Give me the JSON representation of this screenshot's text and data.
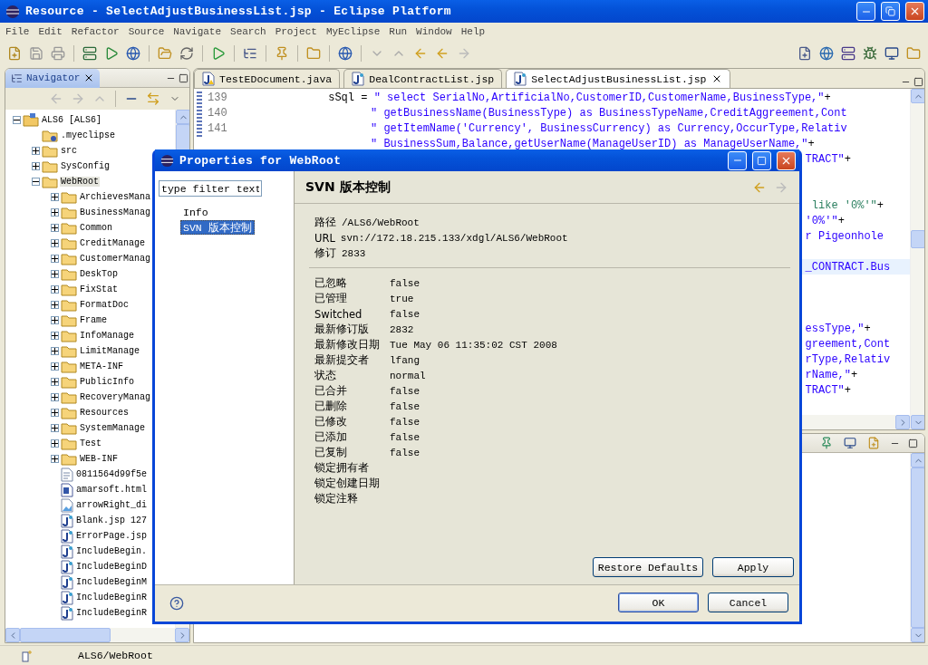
{
  "window": {
    "title": "Resource - SelectAdjustBusinessList.jsp - Eclipse Platform"
  },
  "menu": [
    "File",
    "Edit",
    "Refactor",
    "Source",
    "Navigate",
    "Search",
    "Project",
    "MyEclipse",
    "Run",
    "Window",
    "Help"
  ],
  "navigator": {
    "title": "Navigator",
    "tree": [
      {
        "label": "ALS6 [ALS6]",
        "kind": "project",
        "expanded": true,
        "selected": false,
        "children": [
          {
            "label": ".myeclipse",
            "kind": "meta",
            "selected": false
          },
          {
            "label": "src",
            "kind": "folder",
            "expanded": false,
            "selected": false
          },
          {
            "label": "SysConfig",
            "kind": "folder",
            "expanded": false,
            "selected": false
          },
          {
            "label": "WebRoot",
            "kind": "folder",
            "expanded": true,
            "selected": true,
            "children": [
              {
                "label": "ArchievesMana",
                "kind": "folder",
                "expanded": false,
                "selected": false
              },
              {
                "label": "BusinessManag",
                "kind": "folder",
                "expanded": false,
                "selected": false
              },
              {
                "label": "Common",
                "kind": "folder",
                "expanded": false,
                "selected": false
              },
              {
                "label": "CreditManage",
                "kind": "folder",
                "expanded": false,
                "selected": false
              },
              {
                "label": "CustomerManag",
                "kind": "folder",
                "expanded": false,
                "selected": false
              },
              {
                "label": "DeskTop",
                "kind": "folder",
                "expanded": false,
                "selected": false
              },
              {
                "label": "FixStat",
                "kind": "folder",
                "expanded": false,
                "selected": false
              },
              {
                "label": "FormatDoc",
                "kind": "folder",
                "expanded": false,
                "selected": false
              },
              {
                "label": "Frame",
                "kind": "folder",
                "expanded": false,
                "selected": false
              },
              {
                "label": "InfoManage",
                "kind": "folder",
                "expanded": false,
                "selected": false
              },
              {
                "label": "LimitManage",
                "kind": "folder",
                "expanded": false,
                "selected": false
              },
              {
                "label": "META-INF",
                "kind": "folder",
                "expanded": false,
                "selected": false
              },
              {
                "label": "PublicInfo",
                "kind": "folder",
                "expanded": false,
                "selected": false
              },
              {
                "label": "RecoveryManag",
                "kind": "folder",
                "expanded": false,
                "selected": false
              },
              {
                "label": "Resources",
                "kind": "folder",
                "expanded": false,
                "selected": false
              },
              {
                "label": "SystemManage",
                "kind": "folder",
                "expanded": false,
                "selected": false
              },
              {
                "label": "Test",
                "kind": "folder",
                "expanded": false,
                "selected": false
              },
              {
                "label": "WEB-INF",
                "kind": "folder",
                "expanded": false,
                "selected": false
              },
              {
                "label": "0811564d99f5e",
                "kind": "file",
                "selected": false
              },
              {
                "label": "amarsoft.html",
                "kind": "html",
                "selected": false
              },
              {
                "label": "arrowRight_di",
                "kind": "image",
                "selected": false
              },
              {
                "label": "Blank.jsp 127",
                "kind": "jsp",
                "selected": false
              },
              {
                "label": "ErrorPage.jsp",
                "kind": "jsp",
                "selected": false
              },
              {
                "label": "IncludeBegin.",
                "kind": "jsp",
                "selected": false
              },
              {
                "label": "IncludeBeginD",
                "kind": "jsp",
                "selected": false
              },
              {
                "label": "IncludeBeginM",
                "kind": "jsp",
                "selected": false
              },
              {
                "label": "IncludeBeginR",
                "kind": "jsp",
                "selected": false
              },
              {
                "label": "IncludeBeginR",
                "kind": "jsp",
                "selected": false
              }
            ]
          }
        ]
      }
    ]
  },
  "editor": {
    "tabs": [
      {
        "label": "TestEDocument.java",
        "kind": "java",
        "selected": false
      },
      {
        "label": "DealContractList.jsp",
        "kind": "jsp",
        "selected": false
      },
      {
        "label": "SelectAdjustBusinessList.jsp",
        "kind": "jsp",
        "selected": true
      }
    ],
    "lines": [
      {
        "number": "139",
        "kind": "start",
        "current": false,
        "segments": [
          {
            "text": "sSql = ",
            "kind": "plain"
          },
          {
            "text": "\" select SerialNo,ArtificialNo,CustomerID,CustomerName,BusinessType,\"",
            "kind": "string"
          },
          {
            "text": "+",
            "kind": "plain"
          }
        ]
      },
      {
        "number": "140",
        "kind": "cont",
        "current": false,
        "segments": [
          {
            "text": "\" getBusinessName(BusinessType) as BusinessTypeName,CreditAggreement,Cont",
            "kind": "string"
          }
        ]
      },
      {
        "number": "141",
        "kind": "cont",
        "current": false,
        "segments": [
          {
            "text": "\" getItemName('Currency', BusinessCurrency) as Currency,OccurType,Relativ",
            "kind": "string"
          }
        ]
      },
      {
        "kind": "cont",
        "current": false,
        "segments": [
          {
            "text": "\" BusinessSum,Balance,getUserName(ManageUserID) as ManageUserName,\"",
            "kind": "string"
          },
          {
            "text": "+",
            "kind": "plain"
          }
        ]
      },
      {
        "kind": "tail",
        "current": false,
        "segments": [
          {
            "text": "TRACT\"",
            "kind": "string"
          },
          {
            "text": "+",
            "kind": "plain"
          }
        ]
      },
      {
        "current": false
      },
      {
        "current": false
      },
      {
        "kind": "tail",
        "current": false,
        "segments": [
          {
            "text": " like '0%'\"",
            "kind": "sql"
          },
          {
            "text": "+",
            "kind": "plain"
          }
        ]
      },
      {
        "kind": "tail",
        "current": false,
        "segments": [
          {
            "text": "'0%'\"",
            "kind": "string"
          },
          {
            "text": "+",
            "kind": "plain"
          }
        ]
      },
      {
        "kind": "tail",
        "current": false,
        "segments": [
          {
            "text": "r Pigeonhole",
            "kind": "string"
          }
        ]
      },
      {
        "current": false
      },
      {
        "kind": "tail",
        "current": true,
        "segments": [
          {
            "text": "_CONTRACT.Bus",
            "kind": "string"
          }
        ]
      },
      {
        "current": false
      },
      {
        "current": false
      },
      {
        "current": false
      },
      {
        "kind": "tail",
        "current": false,
        "segments": [
          {
            "text": "essType,\"",
            "kind": "string"
          },
          {
            "text": "+",
            "kind": "plain"
          }
        ]
      },
      {
        "kind": "tail",
        "current": false,
        "segments": [
          {
            "text": "greement,Cont",
            "kind": "string"
          }
        ]
      },
      {
        "kind": "tail",
        "current": false,
        "segments": [
          {
            "text": "rType,Relativ",
            "kind": "string"
          }
        ]
      },
      {
        "kind": "tail",
        "current": false,
        "segments": [
          {
            "text": "rName,\"",
            "kind": "string"
          },
          {
            "text": "+",
            "kind": "plain"
          }
        ]
      },
      {
        "kind": "tail",
        "current": false,
        "segments": [
          {
            "text": "TRACT\"",
            "kind": "string"
          },
          {
            "text": "+",
            "kind": "plain"
          }
        ]
      }
    ]
  },
  "dialog": {
    "title": "Properties for WebRoot",
    "filter": {
      "placeholder": "type filter text"
    },
    "pages": [
      {
        "label": "Info",
        "selected": false
      },
      {
        "label": "SVN 版本控制",
        "selected": true
      }
    ],
    "heading": "SVN 版本控制",
    "summary": [
      {
        "label": "路径",
        "value": "/ALS6/WebRoot"
      },
      {
        "label": "URL",
        "value": "svn://172.18.215.133/xdgl/ALS6/WebRoot"
      },
      {
        "label": "修订",
        "value": "2833"
      }
    ],
    "properties": [
      {
        "label": "已忽略",
        "value": "false"
      },
      {
        "label": "已管理",
        "value": "true"
      },
      {
        "label": "Switched",
        "value": "false"
      },
      {
        "label": "最新修订版",
        "value": "2832"
      },
      {
        "label": "最新修改日期",
        "value": "Tue May 06 11:35:02 CST 2008"
      },
      {
        "label": "最新提交者",
        "value": "lfang"
      },
      {
        "label": "状态",
        "value": "normal"
      },
      {
        "label": "已合并",
        "value": "false"
      },
      {
        "label": "已删除",
        "value": "false"
      },
      {
        "label": "已修改",
        "value": "false"
      },
      {
        "label": "已添加",
        "value": "false"
      },
      {
        "label": "已复制",
        "value": "false"
      },
      {
        "label": "锁定拥有者"
      },
      {
        "label": "锁定创建日期"
      },
      {
        "label": "锁定注释"
      }
    ],
    "page_buttons": [
      "Restore Defaults",
      "Apply"
    ],
    "buttons": [
      "OK",
      "Cancel"
    ]
  },
  "status_bar": {
    "path": "ALS6/WebRoot"
  }
}
